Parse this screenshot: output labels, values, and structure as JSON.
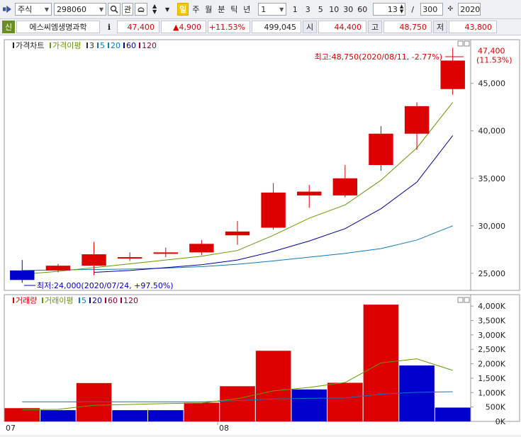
{
  "toolbar": {
    "market": "주식",
    "code": "298060",
    "btn_gwan": "관",
    "period_active": "일",
    "periods": [
      "주",
      "월",
      "분",
      "틱",
      "년"
    ],
    "interval_value": "1",
    "quick": [
      "1",
      "3",
      "5",
      "10",
      "30",
      "60"
    ],
    "count_value": "13",
    "slash": "/",
    "total_value": "300",
    "date_value": "2020/"
  },
  "infobar": {
    "badge": "신",
    "name": "에스씨엠생명과학",
    "info": "i",
    "price": "47,400",
    "change": "▲4,900",
    "change_pct": "+11.53%",
    "volume": "499,045",
    "open_label": "시",
    "open": "44,400",
    "high_label": "고",
    "high": "48,750",
    "low_label": "저",
    "low": "43,800"
  },
  "colors": {
    "up": "#dd0000",
    "down": "#0000cc",
    "ma5": "#669900",
    "ma20": "#1177bb",
    "ma60": "#000099",
    "ma120": "#990033"
  },
  "chart_data": [
    {
      "type": "candlestick",
      "legend": [
        "가격차트",
        "가격이평",
        "3",
        "5",
        "20",
        "60",
        "120"
      ],
      "ylim": [
        23200,
        49600
      ],
      "yticks": [
        25000,
        30000,
        35000,
        40000,
        45000
      ],
      "ytick_labels": [
        "25,000",
        "30,000",
        "35,000",
        "40,000",
        "45,000"
      ],
      "candles": [
        {
          "o": 25300,
          "c": 24300,
          "h": 26400,
          "l": 24000
        },
        {
          "o": 25300,
          "c": 25800,
          "h": 26000,
          "l": 25100
        },
        {
          "o": 25800,
          "c": 27000,
          "h": 28300,
          "l": 24800
        },
        {
          "o": 26700,
          "c": 26700,
          "h": 27200,
          "l": 26300
        },
        {
          "o": 27100,
          "c": 27200,
          "h": 27700,
          "l": 26700
        },
        {
          "o": 27200,
          "c": 28100,
          "h": 28500,
          "l": 26900
        },
        {
          "o": 29000,
          "c": 29400,
          "h": 30500,
          "l": 28000
        },
        {
          "o": 29800,
          "c": 33500,
          "h": 34500,
          "l": 29600
        },
        {
          "o": 33200,
          "c": 33600,
          "h": 34300,
          "l": 31900
        },
        {
          "o": 33200,
          "c": 35000,
          "h": 36400,
          "l": 33000
        },
        {
          "o": 36400,
          "c": 39700,
          "h": 40500,
          "l": 35800
        },
        {
          "o": 39700,
          "c": 42600,
          "h": 43000,
          "l": 38000
        },
        {
          "o": 44400,
          "c": 47400,
          "h": 48750,
          "l": 43800
        }
      ],
      "ma5": [
        24900,
        25200,
        25600,
        26000,
        26400,
        26800,
        27400,
        29000,
        30800,
        32200,
        34800,
        38200,
        43000
      ],
      "ma20": [
        null,
        null,
        25100,
        25300,
        25600,
        25900,
        26400,
        27300,
        28400,
        29700,
        31800,
        34600,
        39500
      ],
      "ma60": [
        25300,
        25350,
        25400,
        25450,
        25550,
        25700,
        25950,
        26300,
        26700,
        27100,
        27600,
        28500,
        30000
      ],
      "last_price_label": "47,400",
      "last_pct_label": "(11.53%)",
      "high_annotation": "최고:48,750(2020/08/11, -2.77%)",
      "low_annotation": "최저:24,000(2020/07/24, +97.50%)",
      "x_labels": [
        "07",
        "08"
      ]
    },
    {
      "type": "bar",
      "legend": [
        "거래량",
        "거래이평",
        "5",
        "20",
        "60",
        "120"
      ],
      "ylim": [
        0,
        4200000
      ],
      "yticks": [
        0,
        500000,
        1000000,
        1500000,
        2000000,
        2500000,
        3000000,
        3500000,
        4000000
      ],
      "ytick_labels": [
        "0K",
        "500K",
        "1,000K",
        "1,500K",
        "2,000K",
        "2,500K",
        "3,000K",
        "3,500K",
        "4,000K"
      ],
      "values": [
        460000,
        390000,
        1330000,
        390000,
        390000,
        650000,
        1220000,
        2450000,
        1110000,
        1340000,
        4050000,
        1940000,
        480000
      ],
      "up": [
        true,
        false,
        true,
        false,
        false,
        true,
        true,
        true,
        false,
        true,
        true,
        false,
        false
      ],
      "ma5": [
        400000,
        420000,
        560000,
        590000,
        620000,
        640000,
        790000,
        1060000,
        1180000,
        1350000,
        2030000,
        2170000,
        1770000
      ],
      "ma20": [
        680000,
        680000,
        680000,
        680000,
        680000,
        680000,
        720000,
        780000,
        800000,
        810000,
        950000,
        1010000,
        1030000
      ]
    }
  ]
}
